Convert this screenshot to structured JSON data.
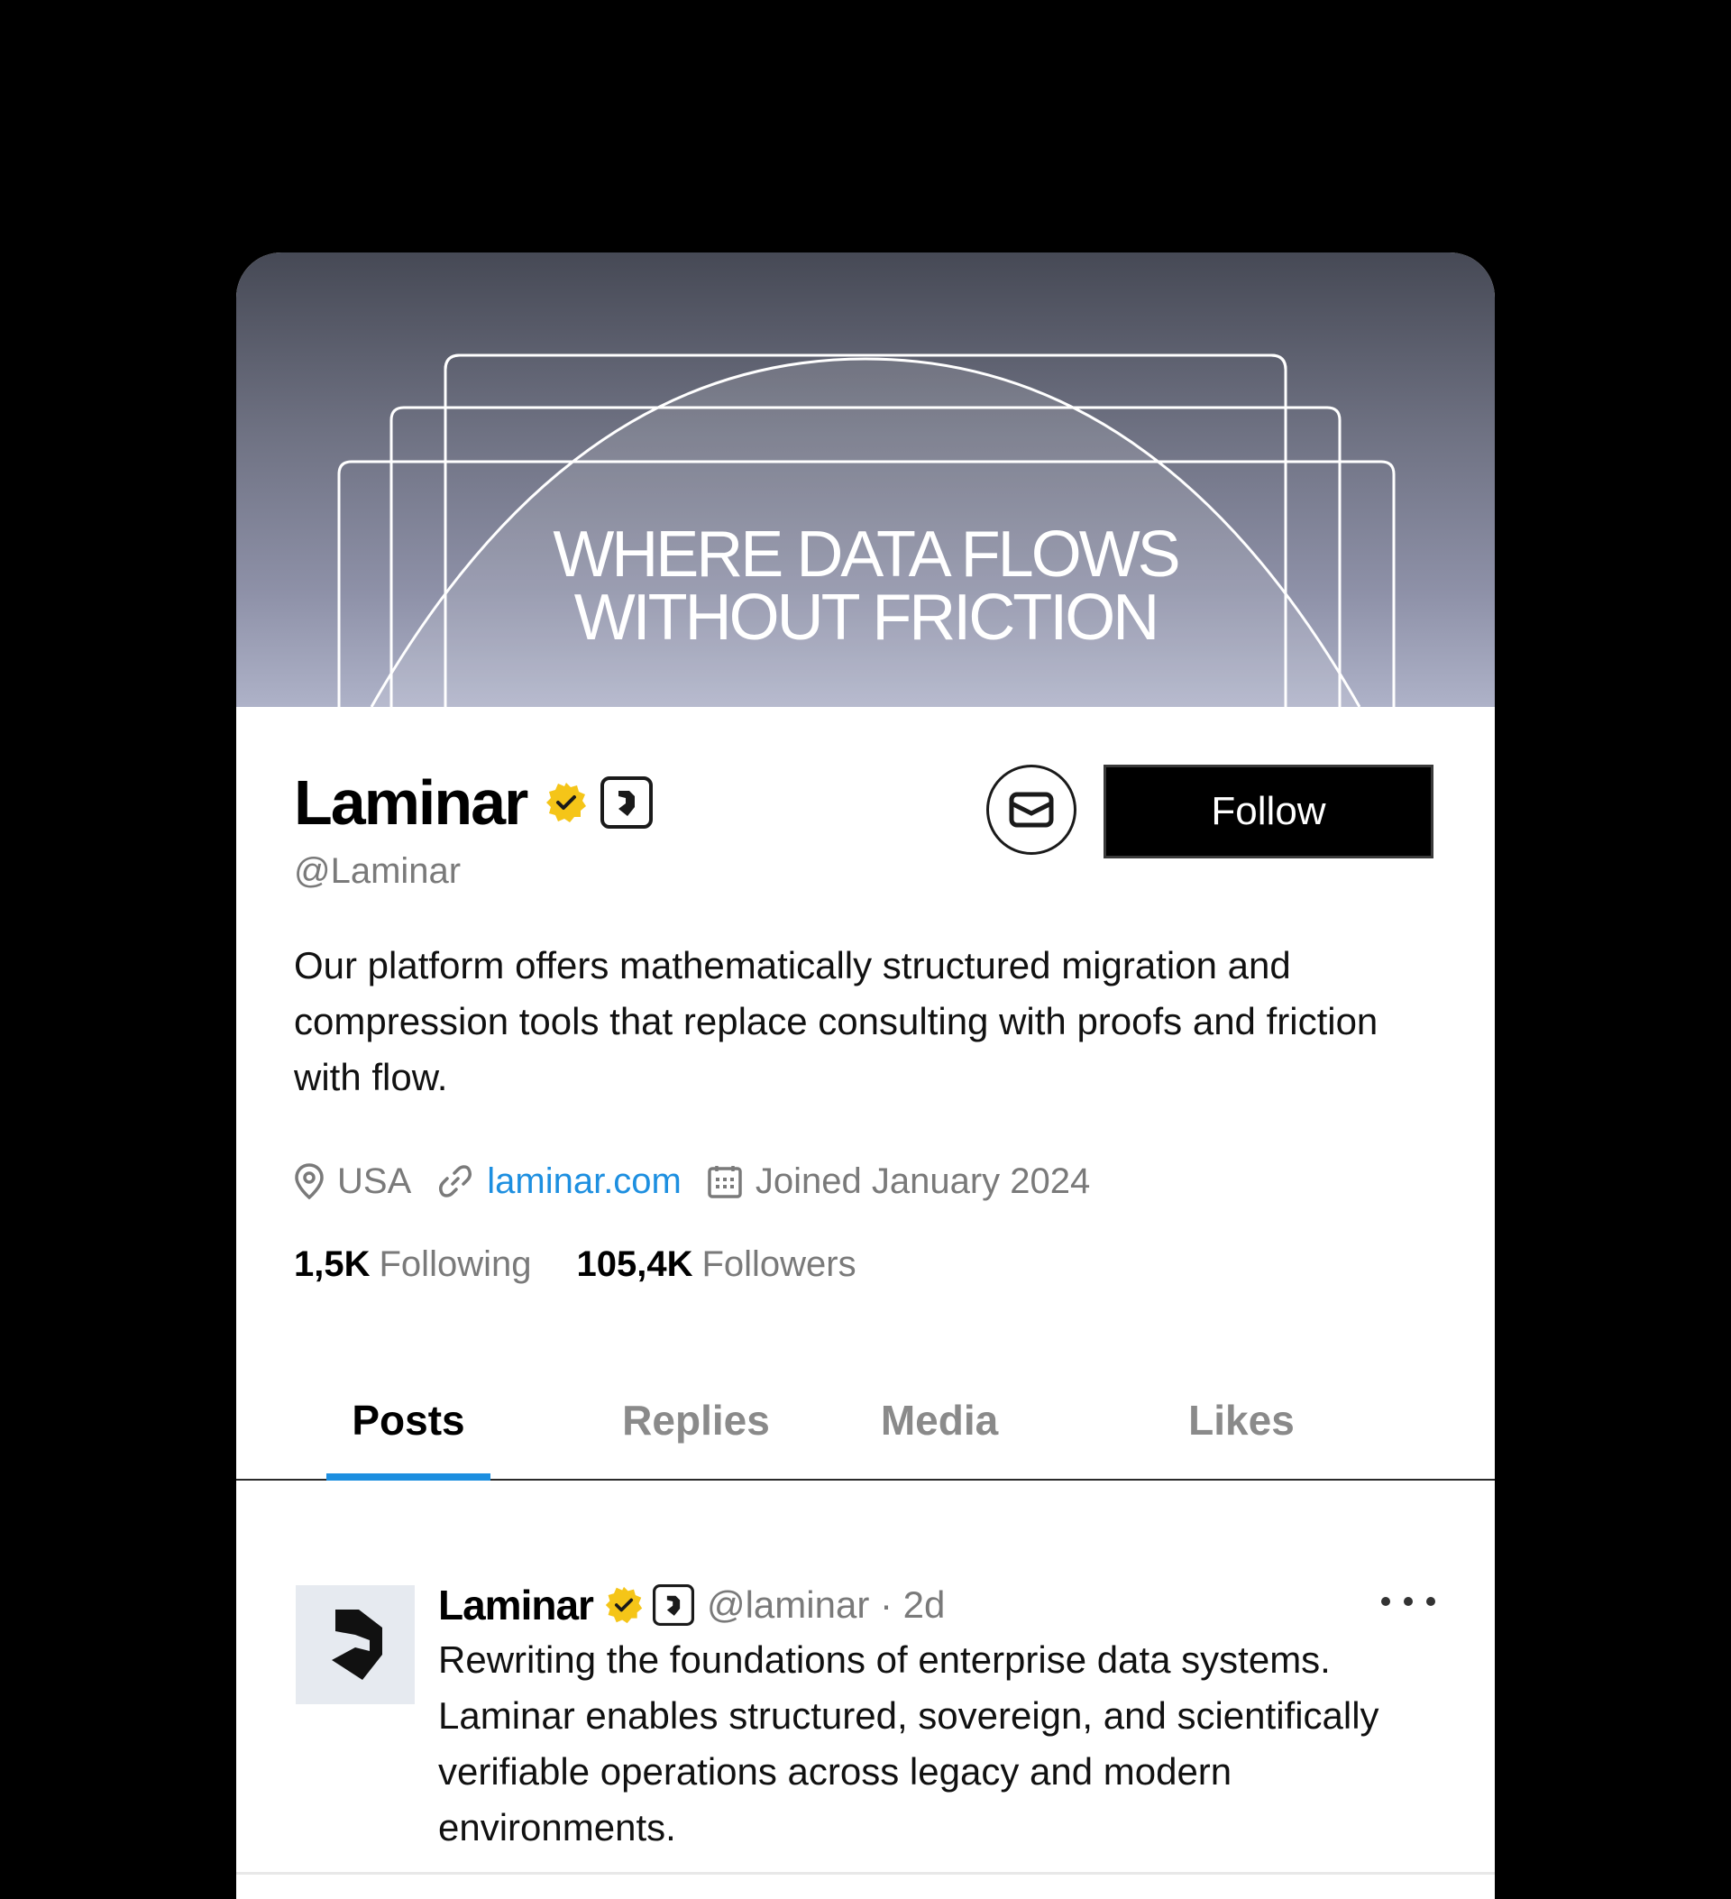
{
  "banner": {
    "line1": "WHERE DATA FLOWS",
    "line2": "WITHOUT FRICTION"
  },
  "profile": {
    "name": "Laminar",
    "handle": "@Laminar",
    "bio": "Our platform offers mathematically structured migration and compression tools that replace consulting with proofs and friction with flow.",
    "location": "USA",
    "website": "laminar.com",
    "joined": "Joined January 2024",
    "following_count": "1,5K",
    "following_label": "Following",
    "followers_count": "105,4K",
    "followers_label": "Followers"
  },
  "actions": {
    "follow_label": "Follow",
    "message_icon": "envelope-icon"
  },
  "tabs": [
    {
      "label": "Posts",
      "active": true
    },
    {
      "label": "Replies",
      "active": false
    },
    {
      "label": "Media",
      "active": false
    },
    {
      "label": "Likes",
      "active": false
    }
  ],
  "post": {
    "name": "Laminar",
    "handle_time": "@laminar · 2d",
    "text": "Rewriting the foundations of enterprise data systems. Laminar enables structured, sovereign, and scientifically verifiable operations across legacy and modern environments."
  },
  "colors": {
    "accent": "#1d8fe0",
    "verified_gold": "#f5c518",
    "follow_bg": "#000000"
  }
}
